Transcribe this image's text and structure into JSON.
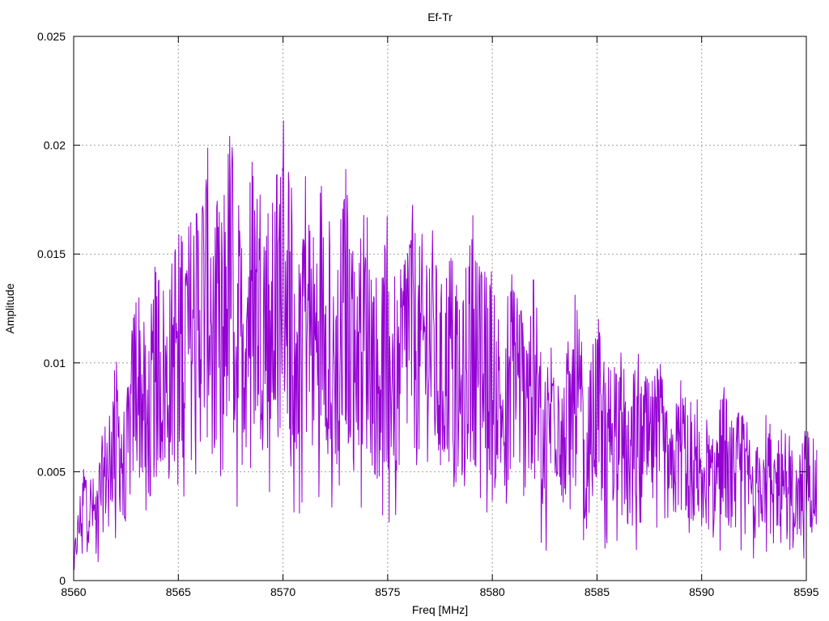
{
  "chart_data": {
    "type": "line",
    "title": "Ef-Tr",
    "xlabel": "Freq [MHz]",
    "ylabel": "Amplitude",
    "xlim": [
      8560,
      8595
    ],
    "ylim": [
      0,
      0.025
    ],
    "grid": true,
    "legend": "none",
    "x_ticks": [
      8560,
      8565,
      8570,
      8575,
      8580,
      8585,
      8590,
      8595
    ],
    "x_tick_labels": [
      "8560",
      "8565",
      "8570",
      "8575",
      "8580",
      "8585",
      "8590",
      "8595"
    ],
    "y_ticks": [
      0,
      0.005,
      0.01,
      0.015,
      0.02,
      0.025
    ],
    "y_tick_labels": [
      "0",
      "0.005",
      "0.01",
      "0.015",
      "0.02",
      "0.025"
    ],
    "series": [
      {
        "color": "#9400d3",
        "x_start": 8560,
        "x_step": 0.5,
        "values": [
          0.0012,
          0.0055,
          0.0042,
          0.0068,
          0.0095,
          0.0072,
          0.0135,
          0.0098,
          0.0142,
          0.0118,
          0.0165,
          0.0152,
          0.0172,
          0.0183,
          0.0155,
          0.0198,
          0.0148,
          0.0186,
          0.0172,
          0.016,
          0.0205,
          0.0168,
          0.0185,
          0.0145,
          0.0192,
          0.0132,
          0.0176,
          0.015,
          0.0162,
          0.0128,
          0.0155,
          0.0118,
          0.0168,
          0.014,
          0.0158,
          0.0122,
          0.0146,
          0.0108,
          0.0162,
          0.013,
          0.0135,
          0.0105,
          0.0148,
          0.0115,
          0.0128,
          0.0088,
          0.0118,
          0.0095,
          0.0122,
          0.008,
          0.0112,
          0.0092,
          0.0105,
          0.0078,
          0.0098,
          0.0082,
          0.0092,
          0.0062,
          0.0088,
          0.0075,
          0.008,
          0.0058,
          0.0085,
          0.0065,
          0.0078,
          0.0052,
          0.0072,
          0.006,
          0.007,
          0.0048,
          0.0068,
          0.0055
        ]
      }
    ]
  }
}
